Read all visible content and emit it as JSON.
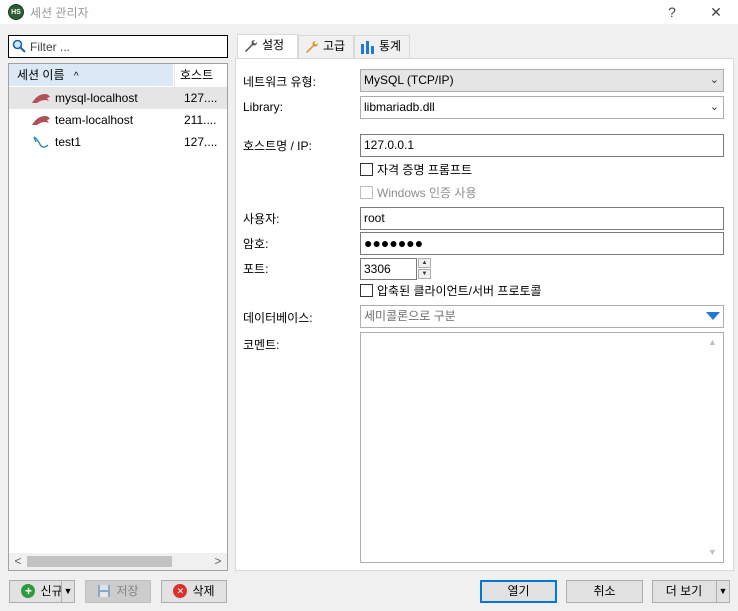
{
  "window": {
    "title": "세션 관리자",
    "app_icon_text": "HS",
    "help_label": "?",
    "close_label": "✕"
  },
  "filter": {
    "placeholder": "Filter ..."
  },
  "session_list": {
    "columns": {
      "name": "세션 이름",
      "host": "호스트",
      "sort_indicator": "^"
    },
    "rows": [
      {
        "name": "mysql-localhost",
        "host": "127....",
        "icon": "mysql-dolphin-icon",
        "selected": true
      },
      {
        "name": "team-localhost",
        "host": "211....",
        "icon": "mysql-dolphin-icon",
        "selected": false
      },
      {
        "name": "test1",
        "host": "127....",
        "icon": "generic-db-icon",
        "selected": false
      }
    ],
    "scroll_left": "<",
    "scroll_right": ">"
  },
  "tabs": [
    {
      "label": "설정",
      "icon": "wrench-icon",
      "active": true
    },
    {
      "label": "고급",
      "icon": "wrench-orange-icon",
      "active": false
    },
    {
      "label": "통계",
      "icon": "bar-chart-icon",
      "active": false
    }
  ],
  "settings": {
    "network_type": {
      "label": "네트워크 유형:",
      "value": "MySQL (TCP/IP)"
    },
    "library": {
      "label": "Library:",
      "value": "libmariadb.dll"
    },
    "hostname": {
      "label": "호스트명 / IP:",
      "value": "127.0.0.1"
    },
    "credential_prompt": {
      "label": "자격 증명 프롬프트",
      "checked": false
    },
    "windows_auth": {
      "label": "Windows 인증 사용",
      "checked": false,
      "disabled": true
    },
    "user": {
      "label": "사용자:",
      "value": "root"
    },
    "password": {
      "label": "암호:",
      "value": "●●●●●●●"
    },
    "port": {
      "label": "포트:",
      "value": "3306"
    },
    "compressed_protocol": {
      "label": "압축된 클라이언트/서버 프로토콜",
      "checked": false
    },
    "databases": {
      "label": "데이터베이스:",
      "placeholder": "세미콜론으로 구분"
    },
    "comment": {
      "label": "코멘트:",
      "value": ""
    }
  },
  "buttons": {
    "new": "신규",
    "save": "저장",
    "delete": "삭제",
    "open": "열기",
    "cancel": "취소",
    "more": "더 보기"
  },
  "colors": {
    "selection_bg": "#e5e5e5",
    "header_bg": "#dbe8f6",
    "primary_border": "#0078d7",
    "dropdown_arrow": "#1e7ad6"
  }
}
